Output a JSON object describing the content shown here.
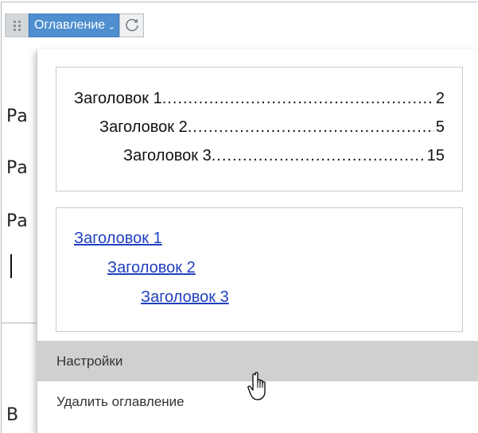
{
  "toolbar": {
    "toc_button_label": "Оглавление",
    "chevron_glyph": "⌄",
    "refresh_icon": "refresh-icon",
    "accent_color": "#4f8fcf"
  },
  "document": {
    "fragments": [
      "Ра",
      "Ра",
      "Ра",
      "В"
    ]
  },
  "dropdown": {
    "style_dotted": {
      "entries": [
        {
          "label": "Заголовок 1",
          "page": "2"
        },
        {
          "label": "Заголовок 2",
          "page": "5"
        },
        {
          "label": "Заголовок 3",
          "page": "15"
        }
      ]
    },
    "style_links": {
      "entries": [
        "Заголовок 1",
        "Заголовок 2",
        "Заголовок 3"
      ],
      "link_color": "#1f3fbf"
    },
    "menu": {
      "settings": "Настройки",
      "delete": "Удалить оглавление"
    }
  }
}
